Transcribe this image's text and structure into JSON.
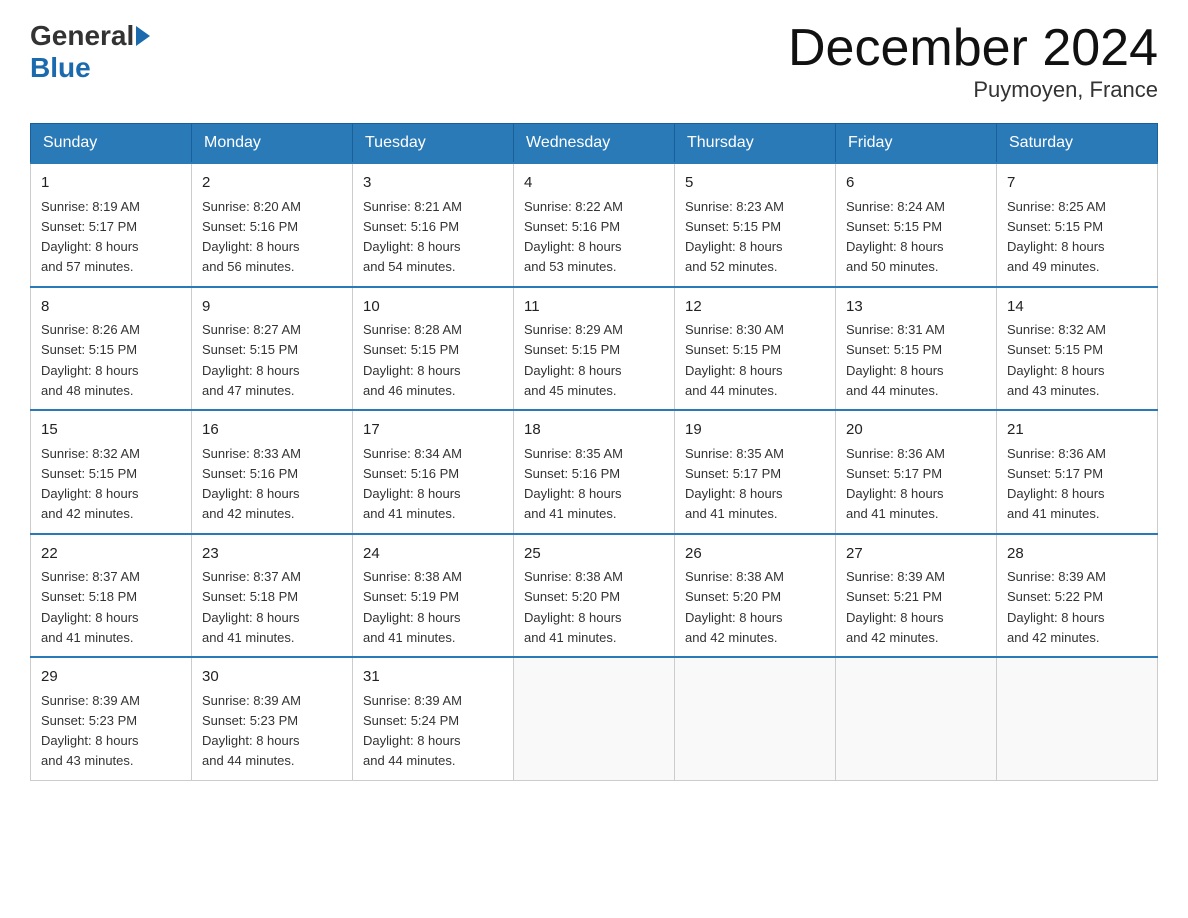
{
  "header": {
    "logo_general": "General",
    "logo_blue": "Blue",
    "title": "December 2024",
    "location": "Puymoyen, France"
  },
  "weekdays": [
    "Sunday",
    "Monday",
    "Tuesday",
    "Wednesday",
    "Thursday",
    "Friday",
    "Saturday"
  ],
  "weeks": [
    [
      {
        "day": "1",
        "sunrise": "Sunrise: 8:19 AM",
        "sunset": "Sunset: 5:17 PM",
        "daylight": "Daylight: 8 hours",
        "daylight2": "and 57 minutes."
      },
      {
        "day": "2",
        "sunrise": "Sunrise: 8:20 AM",
        "sunset": "Sunset: 5:16 PM",
        "daylight": "Daylight: 8 hours",
        "daylight2": "and 56 minutes."
      },
      {
        "day": "3",
        "sunrise": "Sunrise: 8:21 AM",
        "sunset": "Sunset: 5:16 PM",
        "daylight": "Daylight: 8 hours",
        "daylight2": "and 54 minutes."
      },
      {
        "day": "4",
        "sunrise": "Sunrise: 8:22 AM",
        "sunset": "Sunset: 5:16 PM",
        "daylight": "Daylight: 8 hours",
        "daylight2": "and 53 minutes."
      },
      {
        "day": "5",
        "sunrise": "Sunrise: 8:23 AM",
        "sunset": "Sunset: 5:15 PM",
        "daylight": "Daylight: 8 hours",
        "daylight2": "and 52 minutes."
      },
      {
        "day": "6",
        "sunrise": "Sunrise: 8:24 AM",
        "sunset": "Sunset: 5:15 PM",
        "daylight": "Daylight: 8 hours",
        "daylight2": "and 50 minutes."
      },
      {
        "day": "7",
        "sunrise": "Sunrise: 8:25 AM",
        "sunset": "Sunset: 5:15 PM",
        "daylight": "Daylight: 8 hours",
        "daylight2": "and 49 minutes."
      }
    ],
    [
      {
        "day": "8",
        "sunrise": "Sunrise: 8:26 AM",
        "sunset": "Sunset: 5:15 PM",
        "daylight": "Daylight: 8 hours",
        "daylight2": "and 48 minutes."
      },
      {
        "day": "9",
        "sunrise": "Sunrise: 8:27 AM",
        "sunset": "Sunset: 5:15 PM",
        "daylight": "Daylight: 8 hours",
        "daylight2": "and 47 minutes."
      },
      {
        "day": "10",
        "sunrise": "Sunrise: 8:28 AM",
        "sunset": "Sunset: 5:15 PM",
        "daylight": "Daylight: 8 hours",
        "daylight2": "and 46 minutes."
      },
      {
        "day": "11",
        "sunrise": "Sunrise: 8:29 AM",
        "sunset": "Sunset: 5:15 PM",
        "daylight": "Daylight: 8 hours",
        "daylight2": "and 45 minutes."
      },
      {
        "day": "12",
        "sunrise": "Sunrise: 8:30 AM",
        "sunset": "Sunset: 5:15 PM",
        "daylight": "Daylight: 8 hours",
        "daylight2": "and 44 minutes."
      },
      {
        "day": "13",
        "sunrise": "Sunrise: 8:31 AM",
        "sunset": "Sunset: 5:15 PM",
        "daylight": "Daylight: 8 hours",
        "daylight2": "and 44 minutes."
      },
      {
        "day": "14",
        "sunrise": "Sunrise: 8:32 AM",
        "sunset": "Sunset: 5:15 PM",
        "daylight": "Daylight: 8 hours",
        "daylight2": "and 43 minutes."
      }
    ],
    [
      {
        "day": "15",
        "sunrise": "Sunrise: 8:32 AM",
        "sunset": "Sunset: 5:15 PM",
        "daylight": "Daylight: 8 hours",
        "daylight2": "and 42 minutes."
      },
      {
        "day": "16",
        "sunrise": "Sunrise: 8:33 AM",
        "sunset": "Sunset: 5:16 PM",
        "daylight": "Daylight: 8 hours",
        "daylight2": "and 42 minutes."
      },
      {
        "day": "17",
        "sunrise": "Sunrise: 8:34 AM",
        "sunset": "Sunset: 5:16 PM",
        "daylight": "Daylight: 8 hours",
        "daylight2": "and 41 minutes."
      },
      {
        "day": "18",
        "sunrise": "Sunrise: 8:35 AM",
        "sunset": "Sunset: 5:16 PM",
        "daylight": "Daylight: 8 hours",
        "daylight2": "and 41 minutes."
      },
      {
        "day": "19",
        "sunrise": "Sunrise: 8:35 AM",
        "sunset": "Sunset: 5:17 PM",
        "daylight": "Daylight: 8 hours",
        "daylight2": "and 41 minutes."
      },
      {
        "day": "20",
        "sunrise": "Sunrise: 8:36 AM",
        "sunset": "Sunset: 5:17 PM",
        "daylight": "Daylight: 8 hours",
        "daylight2": "and 41 minutes."
      },
      {
        "day": "21",
        "sunrise": "Sunrise: 8:36 AM",
        "sunset": "Sunset: 5:17 PM",
        "daylight": "Daylight: 8 hours",
        "daylight2": "and 41 minutes."
      }
    ],
    [
      {
        "day": "22",
        "sunrise": "Sunrise: 8:37 AM",
        "sunset": "Sunset: 5:18 PM",
        "daylight": "Daylight: 8 hours",
        "daylight2": "and 41 minutes."
      },
      {
        "day": "23",
        "sunrise": "Sunrise: 8:37 AM",
        "sunset": "Sunset: 5:18 PM",
        "daylight": "Daylight: 8 hours",
        "daylight2": "and 41 minutes."
      },
      {
        "day": "24",
        "sunrise": "Sunrise: 8:38 AM",
        "sunset": "Sunset: 5:19 PM",
        "daylight": "Daylight: 8 hours",
        "daylight2": "and 41 minutes."
      },
      {
        "day": "25",
        "sunrise": "Sunrise: 8:38 AM",
        "sunset": "Sunset: 5:20 PM",
        "daylight": "Daylight: 8 hours",
        "daylight2": "and 41 minutes."
      },
      {
        "day": "26",
        "sunrise": "Sunrise: 8:38 AM",
        "sunset": "Sunset: 5:20 PM",
        "daylight": "Daylight: 8 hours",
        "daylight2": "and 42 minutes."
      },
      {
        "day": "27",
        "sunrise": "Sunrise: 8:39 AM",
        "sunset": "Sunset: 5:21 PM",
        "daylight": "Daylight: 8 hours",
        "daylight2": "and 42 minutes."
      },
      {
        "day": "28",
        "sunrise": "Sunrise: 8:39 AM",
        "sunset": "Sunset: 5:22 PM",
        "daylight": "Daylight: 8 hours",
        "daylight2": "and 42 minutes."
      }
    ],
    [
      {
        "day": "29",
        "sunrise": "Sunrise: 8:39 AM",
        "sunset": "Sunset: 5:23 PM",
        "daylight": "Daylight: 8 hours",
        "daylight2": "and 43 minutes."
      },
      {
        "day": "30",
        "sunrise": "Sunrise: 8:39 AM",
        "sunset": "Sunset: 5:23 PM",
        "daylight": "Daylight: 8 hours",
        "daylight2": "and 44 minutes."
      },
      {
        "day": "31",
        "sunrise": "Sunrise: 8:39 AM",
        "sunset": "Sunset: 5:24 PM",
        "daylight": "Daylight: 8 hours",
        "daylight2": "and 44 minutes."
      },
      null,
      null,
      null,
      null
    ]
  ]
}
